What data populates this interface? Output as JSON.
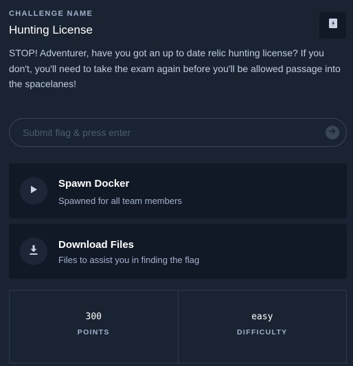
{
  "challenge": {
    "eyebrow": "CHALLENGE NAME",
    "title": "Hunting License",
    "description": "STOP! Adventurer, have you got an up to date relic hunting license? If you don't, you'll need to take the exam again before you'll be allowed passage into the spacelanes!"
  },
  "flag_input": {
    "placeholder": "Submit flag & press enter",
    "value": ""
  },
  "actions": {
    "spawn": {
      "title": "Spawn Docker",
      "subtitle": "Spawned for all team members",
      "icon": "play-icon"
    },
    "download": {
      "title": "Download Files",
      "subtitle": "Files to assist you in finding the flag",
      "icon": "download-icon"
    }
  },
  "stats": {
    "points": {
      "value": "300",
      "label": "POINTS"
    },
    "difficulty": {
      "value": "easy",
      "label": "DIFFICULTY"
    }
  },
  "icons": {
    "reload": "swap-icon",
    "submit": "arrow-right-circle-icon"
  },
  "colors": {
    "background": "#1a2332",
    "card": "#111927",
    "text_primary": "#ffffff",
    "text_muted": "#a4b1cd"
  }
}
